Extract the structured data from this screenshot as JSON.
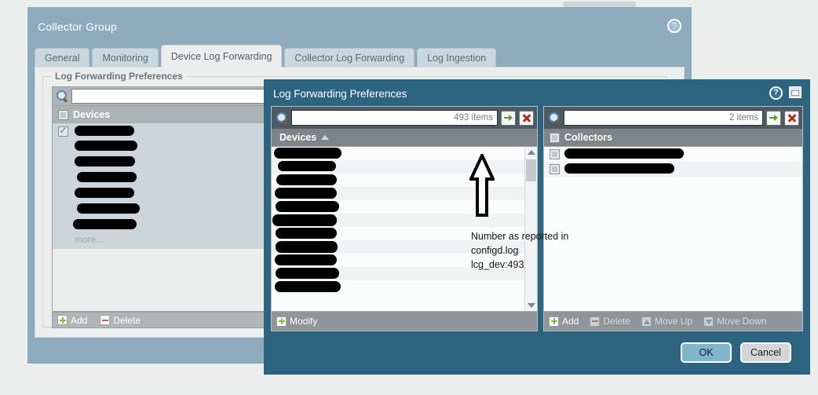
{
  "background_window": {
    "title": "Collector Group",
    "help_icon": "help-circle-icon",
    "tabs": [
      {
        "label": "General",
        "active": false
      },
      {
        "label": "Monitoring",
        "active": false
      },
      {
        "label": "Device Log Forwarding",
        "active": true
      },
      {
        "label": "Collector Log Forwarding",
        "active": false
      },
      {
        "label": "Log Ingestion",
        "active": false
      }
    ],
    "fieldset_legend": "Log Forwarding Preferences",
    "search": {
      "value": "",
      "placeholder": ""
    },
    "list": {
      "header": "Devices",
      "header_checkbox": "unchecked",
      "rows": [
        {
          "label": "",
          "redacted": true,
          "checked": true
        },
        {
          "label": "",
          "redacted": true,
          "checked": false
        },
        {
          "label": "",
          "redacted": true,
          "checked": false
        },
        {
          "label": "",
          "redacted": true,
          "checked": false
        },
        {
          "label": "",
          "redacted": true,
          "checked": false
        },
        {
          "label": "",
          "redacted": true,
          "checked": false
        },
        {
          "label": "",
          "redacted": true,
          "checked": false
        }
      ],
      "more_label": "more..."
    },
    "footer_buttons": [
      {
        "label": "Add",
        "icon": "plus-icon",
        "enabled": true
      },
      {
        "label": "Delete",
        "icon": "minus-icon",
        "enabled": true
      }
    ]
  },
  "modal": {
    "title": "Log Forwarding Preferences",
    "help_icon": "help-circle-icon",
    "restore_icon": "restore-window-icon",
    "left_panel": {
      "search": {
        "value": "",
        "count_label": "493 items"
      },
      "go_icon": "arrow-right-icon",
      "clear_icon": "close-x-icon",
      "header": "Devices",
      "sort": "ascending",
      "row_count": 11,
      "footer_buttons": [
        {
          "label": "Modify",
          "icon": "plus-icon",
          "enabled": true
        }
      ],
      "scrollbar": {
        "up_icon": "chevron-up-icon",
        "down_icon": "chevron-down-icon"
      }
    },
    "right_panel": {
      "search": {
        "value": "",
        "count_label": "2 items"
      },
      "go_icon": "arrow-right-icon",
      "clear_icon": "close-x-icon",
      "header": "Collectors",
      "header_checkbox": "unchecked",
      "rows": [
        {
          "label": "",
          "redacted": true,
          "checked": false
        },
        {
          "label": "",
          "redacted": true,
          "checked": false
        }
      ],
      "footer_buttons": [
        {
          "label": "Add",
          "icon": "plus-icon",
          "enabled": true
        },
        {
          "label": "Delete",
          "icon": "minus-icon",
          "enabled": false
        },
        {
          "label": "Move Up",
          "icon": "arrow-up-icon",
          "enabled": false
        },
        {
          "label": "Move Down",
          "icon": "arrow-down-icon",
          "enabled": false
        }
      ]
    },
    "footer_buttons": [
      {
        "label": "OK",
        "kind": "primary"
      },
      {
        "label": "Cancel",
        "kind": "secondary"
      }
    ]
  },
  "annotation": {
    "arrow": "up-arrow-annotation",
    "text": "Number as reported in\nconfigd.log\nlcg_dev:493"
  },
  "colors": {
    "window_header": "#8dabbd",
    "modal_background": "#2d6480",
    "panel_header": "#7f8488",
    "search_bar": "#4c5a63",
    "ok_button": "#7fb6cc",
    "cancel_button": "#d3d6d7",
    "accent_green": "#6a9a2b",
    "accent_red": "#ad2f21"
  }
}
